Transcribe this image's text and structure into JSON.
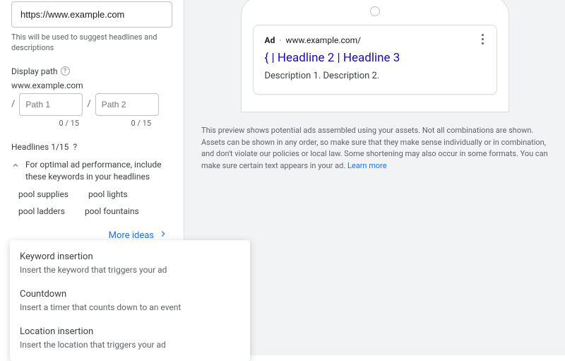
{
  "final_url": {
    "value": "https://www.example.com",
    "help": "This will be used to suggest headlines and descriptions"
  },
  "display_path": {
    "label": "Display path",
    "base": "www.example.com",
    "path1_placeholder": "Path 1",
    "path2_placeholder": "Path 2",
    "counter1": "0 / 15",
    "counter2": "0 / 15"
  },
  "headlines": {
    "label": "Headlines 1/15",
    "hint": "For optimal ad performance, include these keywords in your headlines",
    "keywords_row1": {
      "a": "pool supplies",
      "b": "pool lights"
    },
    "keywords_row2": {
      "a": "pool ladders",
      "b": "pool fountains"
    },
    "more_ideas": "More ideas",
    "input_value": "{|"
  },
  "customizer_dropdown": {
    "items": [
      {
        "title": "Keyword insertion",
        "desc": "Insert the keyword that triggers your ad"
      },
      {
        "title": "Countdown",
        "desc": "Insert a timer that counts down to an event"
      },
      {
        "title": "Location insertion",
        "desc": "Insert the location that triggers your ad"
      }
    ]
  },
  "preview": {
    "ad_label": "Ad",
    "domain": "www.example.com/",
    "headline": "{ | Headline 2 | Headline 3",
    "description": "Description 1. Description 2.",
    "note": "This preview shows potential ads assembled using your assets. Not all combinations are shown. Assets can be shown in any order, so make sure that they make sense individually or in combination, and don't violate our policies or local law. Some shortening may also occur in some formats. You can make sure certain text appears in your ad. ",
    "learn_more": "Learn more"
  }
}
